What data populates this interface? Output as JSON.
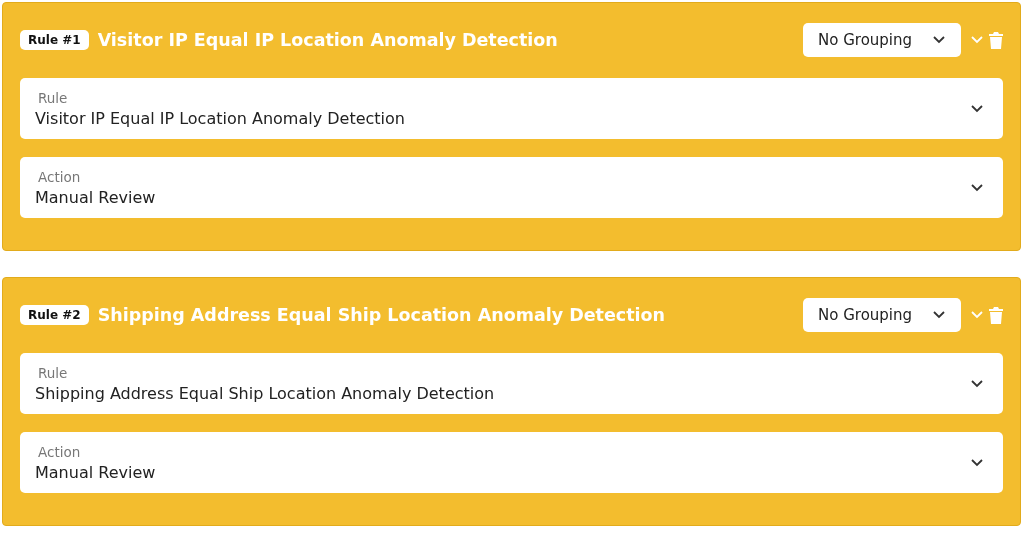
{
  "rules": [
    {
      "badge": "Rule #1",
      "title": "Visitor IP Equal IP Location Anomaly Detection",
      "grouping": "No Grouping",
      "fields": [
        {
          "label": "Rule",
          "value": "Visitor IP Equal IP Location Anomaly Detection"
        },
        {
          "label": "Action",
          "value": "Manual Review"
        }
      ]
    },
    {
      "badge": "Rule #2",
      "title": "Shipping Address Equal Ship Location Anomaly Detection",
      "grouping": "No Grouping",
      "fields": [
        {
          "label": "Rule",
          "value": "Shipping Address Equal Ship Location Anomaly Detection"
        },
        {
          "label": "Action",
          "value": "Manual Review"
        }
      ]
    }
  ]
}
